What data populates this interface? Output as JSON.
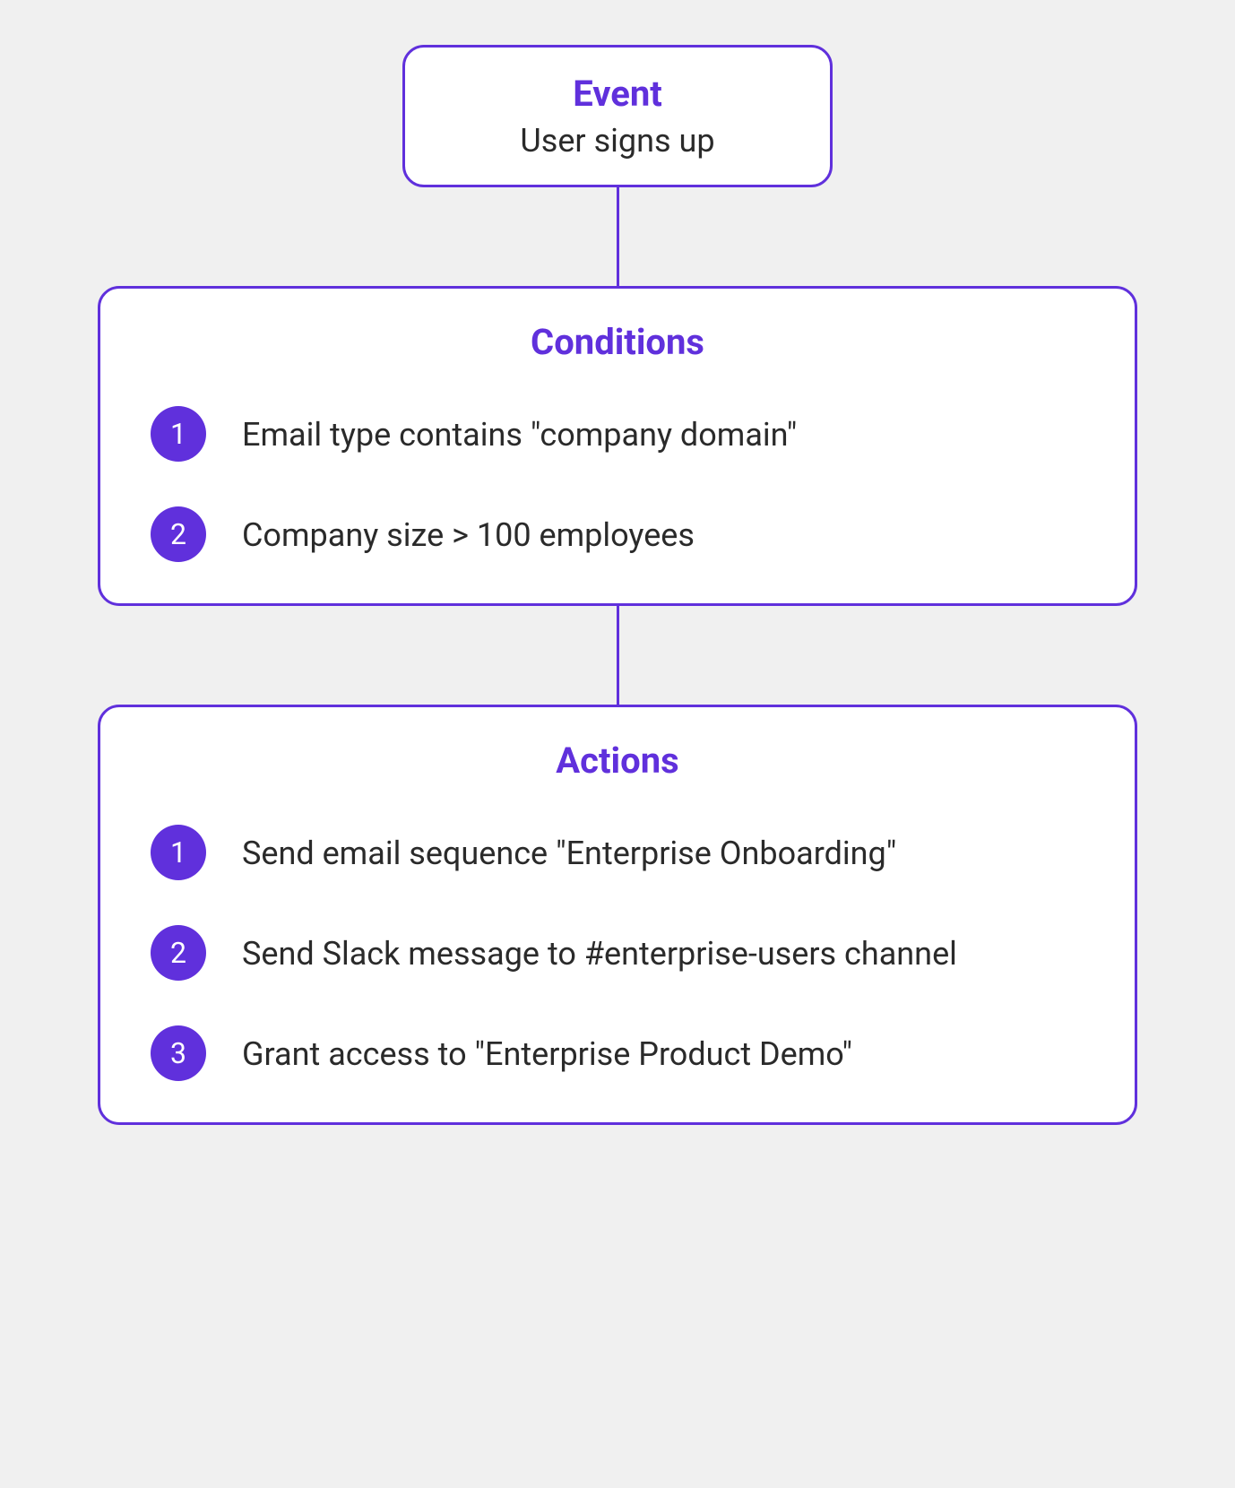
{
  "event": {
    "title": "Event",
    "subtitle": "User signs up"
  },
  "conditions": {
    "title": "Conditions",
    "items": [
      {
        "num": "1",
        "text": "Email type contains \"company domain\""
      },
      {
        "num": "2",
        "text": "Company size > 100 employees"
      }
    ]
  },
  "actions": {
    "title": "Actions",
    "items": [
      {
        "num": "1",
        "text": "Send email sequence \"Enterprise Onboarding\""
      },
      {
        "num": "2",
        "text": "Send Slack message to #enterprise-users channel"
      },
      {
        "num": "3",
        "text": "Grant access to \"Enterprise Product Demo\""
      }
    ]
  }
}
